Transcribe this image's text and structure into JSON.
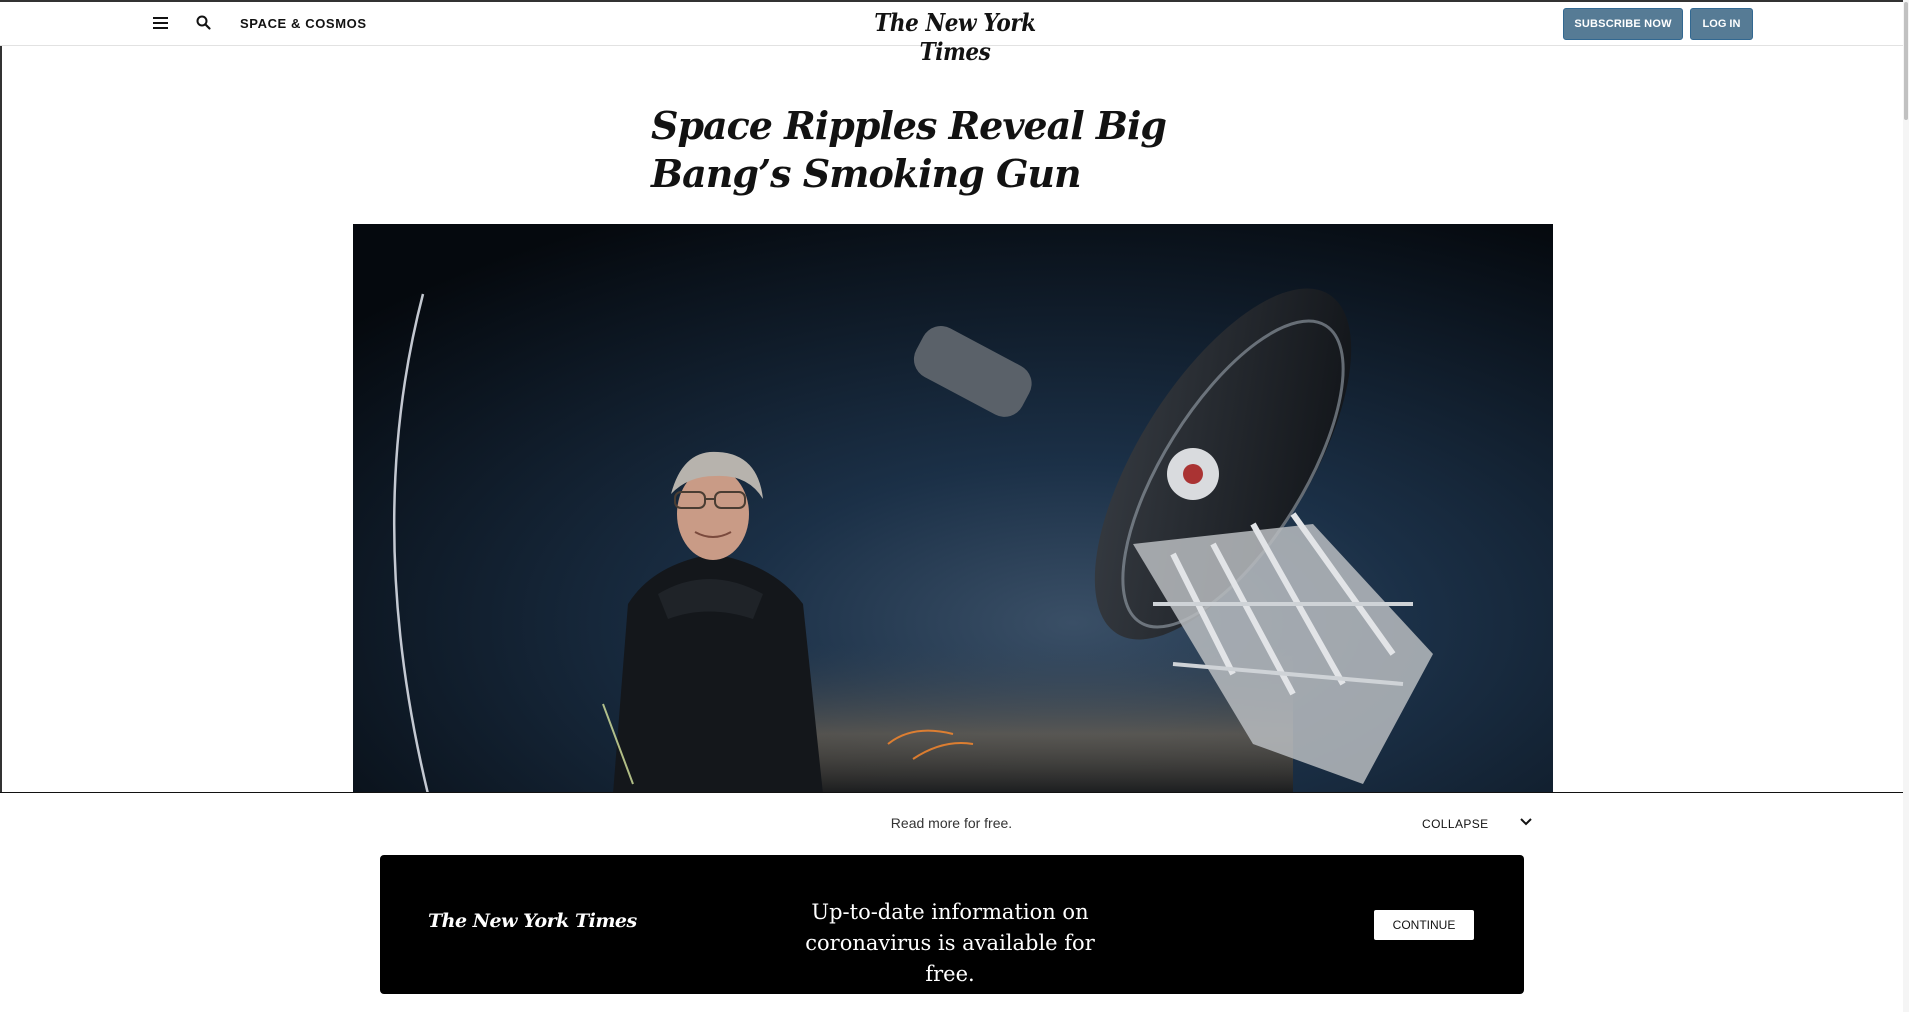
{
  "header": {
    "section_label": "SPACE & COSMOS",
    "logo_text": "The New York Times",
    "subscribe_label": "SUBSCRIBE NOW",
    "login_label": "LOG IN",
    "menu_icon": "hamburger-menu-icon",
    "search_icon": "search-icon"
  },
  "article": {
    "headline": "Space Ripples Reveal Big Bang’s Smoking Gun"
  },
  "overlay": {
    "read_more": "Read more for free.",
    "collapse_label": "COLLAPSE",
    "collapse_icon": "chevron-down-icon",
    "promo_logo": "The New York Times",
    "promo_text": "Up-to-date information on coronavirus is available for free.",
    "continue_label": "CONTINUE"
  },
  "colors": {
    "button_bg": "#567b95",
    "promo_bg": "#000000",
    "text": "#121212"
  }
}
